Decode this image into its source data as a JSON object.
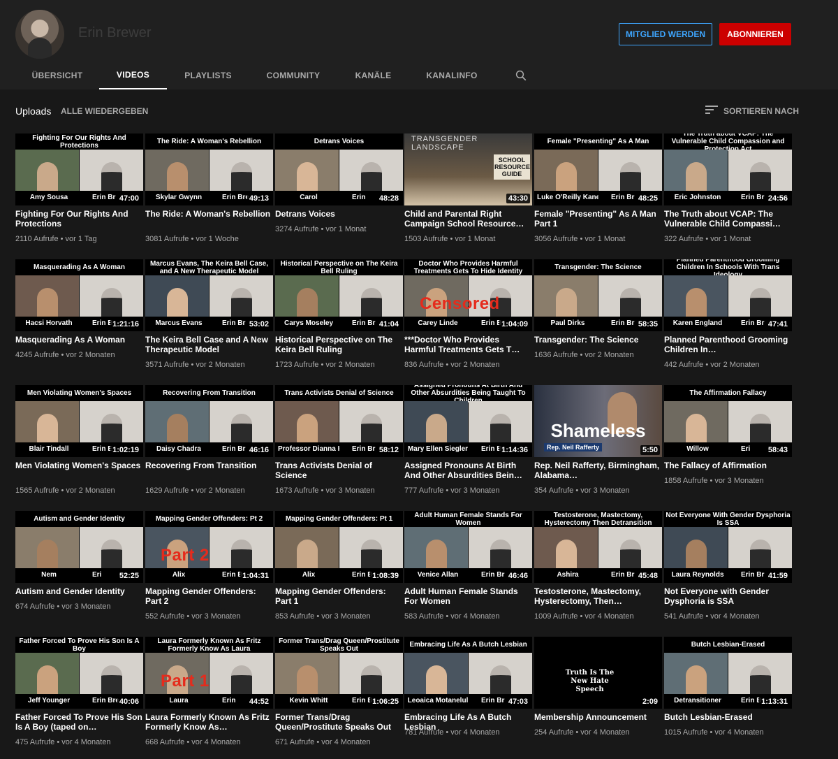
{
  "channel": {
    "name": "Erin Brewer",
    "member_label": "MITGLIED WERDEN",
    "subscribe_label": "ABONNIEREN"
  },
  "tabs": [
    {
      "label": "ÜBERSICHT"
    },
    {
      "label": "VIDEOS"
    },
    {
      "label": "PLAYLISTS"
    },
    {
      "label": "COMMUNITY"
    },
    {
      "label": "KANÄLE"
    },
    {
      "label": "KANALINFO"
    }
  ],
  "uploads": {
    "label": "Uploads",
    "play_all": "ALLE WIEDERGEBEN",
    "sort_label": "SORTIEREN NACH"
  },
  "colors": {
    "background": "#181818",
    "header": "#202020",
    "subscribe": "#cc0000",
    "member": "#3ea6ff"
  },
  "videos": [
    {
      "title": "Fighting For Our Rights And Protections",
      "meta": "2110 Aufrufe • vor 1 Tag",
      "duration": "47:00",
      "thumb_title": "Fighting For Our Rights And Protections",
      "guest": "Amy Sousa",
      "host": "Erin Br"
    },
    {
      "title": "The Ride: A Woman's Rebellion",
      "meta": "3081 Aufrufe • vor 1 Woche",
      "duration": "49:13",
      "thumb_title": "The Ride: A Woman's Rebellion",
      "guest": "Skylar Gwynn",
      "host": "Erin Bre"
    },
    {
      "title": "Detrans Voices",
      "meta": "3274 Aufrufe • vor 1 Monat",
      "duration": "48:28",
      "thumb_title": "Detrans Voices",
      "guest": "Carol",
      "host": "Erin"
    },
    {
      "title": "Child and Parental Right Campaign School Resource…",
      "meta": "1503 Aufrufe • vor 1 Monat",
      "duration": "43:30",
      "thumb_title": "TRANSGENDER LANDSCAPE",
      "guest": "SCHOOL RESOURCE GUIDE",
      "host": ""
    },
    {
      "title": "Female \"Presenting\" As A Man Part 1",
      "meta": "3056 Aufrufe • vor 1 Monat",
      "duration": "48:25",
      "thumb_title": "Female \"Presenting\" As A Man",
      "guest": "Luke O'Reilly Kane",
      "host": "Erin Br"
    },
    {
      "title": "The Truth about VCAP: The Vulnerable Child Compassi…",
      "meta": "322 Aufrufe • vor 1 Monat",
      "duration": "24:56",
      "thumb_title": "The Truth about VCAP: The Vulnerable Child Compassion and Protection Act",
      "guest": "Eric Johnston",
      "host": "Erin Br"
    },
    {
      "title": "Masquerading As A Woman",
      "meta": "4245 Aufrufe • vor 2 Monaten",
      "duration": "1:21:16",
      "thumb_title": "Masquerading As A Woman",
      "guest": "Hacsi Horvath",
      "host": "Erin B"
    },
    {
      "title": "The Keira Bell Case and A New Therapeutic Model",
      "meta": "3571 Aufrufe • vor 2 Monaten",
      "duration": "53:02",
      "thumb_title": "Marcus Evans, The Keira Bell Case, and A New Therapeutic Model",
      "guest": "Marcus Evans",
      "host": "Erin Br"
    },
    {
      "title": "Historical Perspective on The Keira Bell Ruling",
      "meta": "1723 Aufrufe • vor 2 Monaten",
      "duration": "41:04",
      "thumb_title": "Historical Perspective on The Keira Bell Ruling",
      "guest": "Carys Moseley",
      "host": "Erin Br"
    },
    {
      "title": "***Doctor Who Provides Harmful Treatments Gets T…",
      "meta": "836 Aufrufe • vor 2 Monaten",
      "duration": "1:04:09",
      "thumb_title": "Doctor Who Provides Harmful Treatments Gets To Hide Identity",
      "guest": "Carey Linde",
      "host": "Erin B",
      "stamp": "Censored"
    },
    {
      "title": "Transgender: The Science",
      "meta": "1636 Aufrufe • vor 2 Monaten",
      "duration": "58:35",
      "thumb_title": "Transgender: The Science",
      "guest": "Paul Dirks",
      "host": "Erin Br"
    },
    {
      "title": "Planned Parenthood Grooming Children In…",
      "meta": "442 Aufrufe • vor 2 Monaten",
      "duration": "47:41",
      "thumb_title": "Planned Parenthood Grooming Children In Schools With Trans Ideology",
      "guest": "Karen England",
      "host": "Erin Br"
    },
    {
      "title": "Men Violating Women's Spaces",
      "meta": "1565 Aufrufe • vor 2 Monaten",
      "duration": "1:02:19",
      "thumb_title": "Men Violating Women's Spaces",
      "guest": "Blair Tindall",
      "host": "Erin E"
    },
    {
      "title": "Recovering From Transition",
      "meta": "1629 Aufrufe • vor 2 Monaten",
      "duration": "46:16",
      "thumb_title": "Recovering From Transition",
      "guest": "Daisy Chadra",
      "host": "Erin Br"
    },
    {
      "title": "Trans Activists Denial of Science",
      "meta": "1673 Aufrufe • vor 3 Monaten",
      "duration": "58:12",
      "thumb_title": "Trans Activists Denial of Science",
      "guest": "Professor Dianna Kenny",
      "host": "Erin Br"
    },
    {
      "title": "Assigned Pronouns At Birth And Other Absurdities Bein…",
      "meta": "777 Aufrufe • vor 3 Monaten",
      "duration": "1:14:36",
      "thumb_title": "Assigned Pronouns At Birth And Other Absurdities Being Taught To Children",
      "guest": "Mary Ellen Siegler",
      "host": "Erin Br"
    },
    {
      "title": "Rep. Neil Rafferty, Birmingham, Alabama…",
      "meta": "354 Aufrufe • vor 3 Monaten",
      "duration": "5:50",
      "thumb_title": "Shameless",
      "guest": "Rep. Neil Rafferty",
      "host": ""
    },
    {
      "title": "The Fallacy of Affirmation",
      "meta": "1858 Aufrufe • vor 3 Monaten",
      "duration": "58:43",
      "thumb_title": "The Affirmation Fallacy",
      "guest": "Willow",
      "host": "Eri"
    },
    {
      "title": "Autism and Gender Identity",
      "meta": "674 Aufrufe • vor 3 Monaten",
      "duration": "52:25",
      "thumb_title": "Autism and Gender Identity",
      "guest": "Nem",
      "host": "Eri"
    },
    {
      "title": "Mapping Gender Offenders: Part 2",
      "meta": "552 Aufrufe • vor 3 Monaten",
      "duration": "1:04:31",
      "thumb_title": "Mapping Gender Offenders: Pt 2",
      "guest": "Alix",
      "host": "Erin B",
      "stamp": "Part 2"
    },
    {
      "title": "Mapping Gender Offenders: Part 1",
      "meta": "853 Aufrufe • vor 3 Monaten",
      "duration": "1:08:39",
      "thumb_title": "Mapping Gender Offenders: Pt 1",
      "guest": "Alix",
      "host": "Erin B"
    },
    {
      "title": "Adult Human Female Stands For Women",
      "meta": "583 Aufrufe • vor 4 Monaten",
      "duration": "46:46",
      "thumb_title": "Adult Human Female Stands For Women",
      "guest": "Venice Allan",
      "host": "Erin Br"
    },
    {
      "title": "Testosterone, Mastectomy, Hysterectomy, Then…",
      "meta": "1009 Aufrufe • vor 4 Monaten",
      "duration": "45:48",
      "thumb_title": "Testosterone, Mastectomy, Hysterectomy Then Detransition",
      "guest": "Ashira",
      "host": "Erin Br"
    },
    {
      "title": "Not Everyone with Gender Dysphoria is SSA",
      "meta": "541 Aufrufe • vor 4 Monaten",
      "duration": "41:59",
      "thumb_title": "Not Everyone With Gender Dysphoria Is SSA",
      "guest": "Laura Reynolds",
      "host": "Erin Br"
    },
    {
      "title": "Father Forced To Prove His Son Is A Boy (taped on…",
      "meta": "475 Aufrufe • vor 4 Monaten",
      "duration": "40:06",
      "thumb_title": "Father Forced To Prove His Son Is A Boy",
      "guest": "Jeff Younger",
      "host": "Erin Bre"
    },
    {
      "title": "Laura Formerly Known As Fritz Formerly Know As…",
      "meta": "668 Aufrufe • vor 4 Monaten",
      "duration": "44:52",
      "thumb_title": "Laura Formerly Known As Fritz Formerly Know As Laura",
      "guest": "Laura",
      "host": "Erin",
      "stamp": "Part 1"
    },
    {
      "title": "Former Trans/Drag Queen/Prostitute Speaks Out",
      "meta": "671 Aufrufe • vor 4 Monaten",
      "duration": "1:06:25",
      "thumb_title": "Former Trans/Drag Queen/Prostitute Speaks Out",
      "guest": "Kevin Whitt",
      "host": "Erin Br"
    },
    {
      "title": "Embracing Life As A Butch Lesbian",
      "meta": "781 Aufrufe • vor 4 Monaten",
      "duration": "47:03",
      "thumb_title": "Embracing Life As A Butch Lesbian",
      "guest": "Leoaica Motanelul",
      "host": "Erin Br"
    },
    {
      "title": "Membership Announcement",
      "meta": "254 Aufrufe • vor 4 Monaten",
      "duration": "2:09",
      "thumb_title": "Truth Is The New Hate Speech",
      "guest": "",
      "host": ""
    },
    {
      "title": "Butch Lesbian-Erased",
      "meta": "1015 Aufrufe • vor 4 Monaten",
      "duration": "1:13:31",
      "thumb_title": "Butch Lesbian-Erased",
      "guest": "Detransitioner",
      "host": "Erin B"
    }
  ]
}
